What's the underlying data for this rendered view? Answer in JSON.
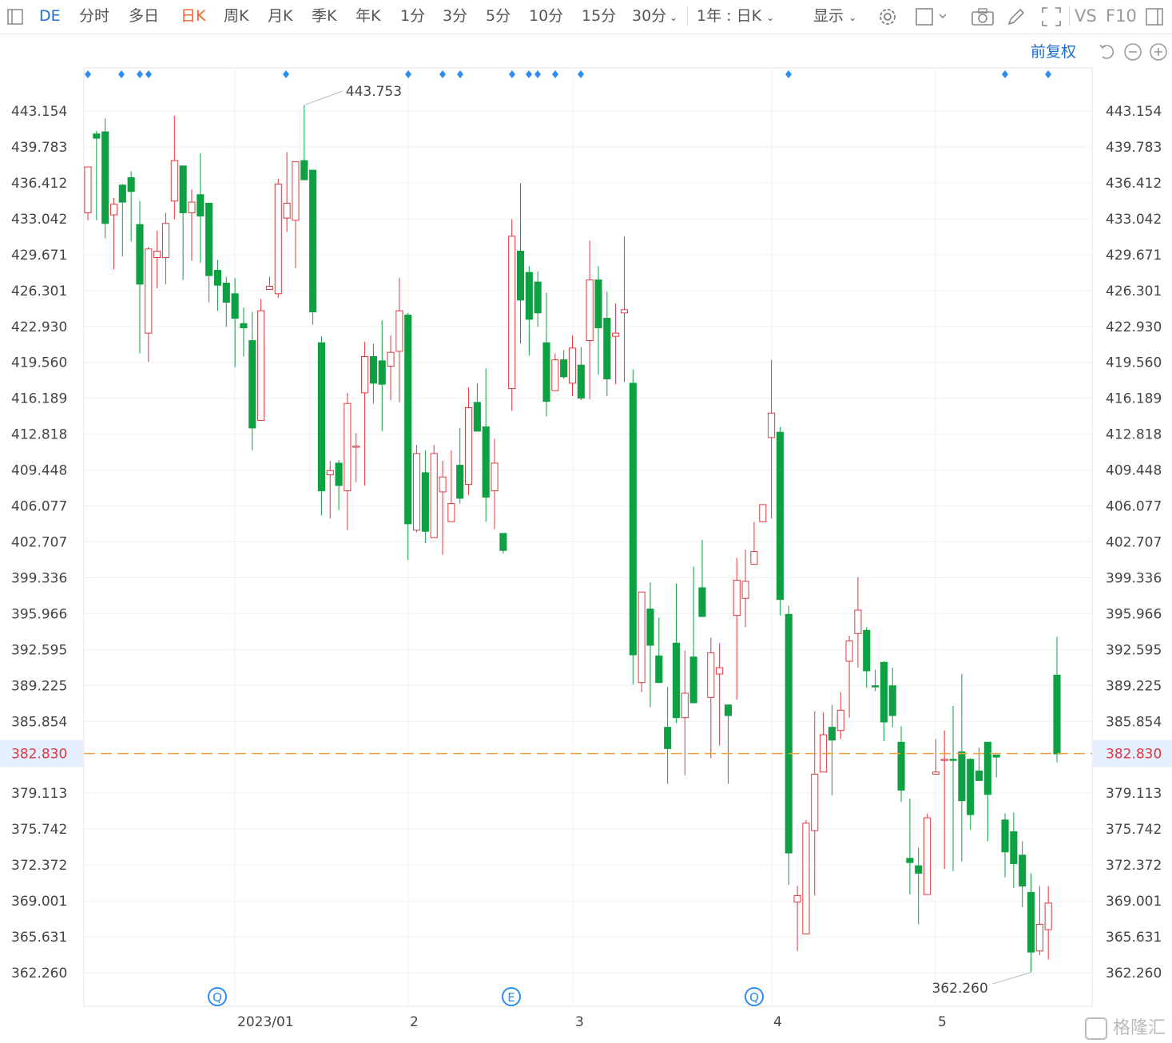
{
  "toolbar": {
    "symbol": "DE",
    "periods": [
      "分时",
      "多日",
      "日K",
      "周K",
      "月K",
      "季K",
      "年K",
      "1分",
      "3分",
      "5分",
      "10分",
      "15分",
      "30分"
    ],
    "active_period": "日K",
    "range_label": "1年 : 日K",
    "display_label": "显示",
    "vs_label": "VS",
    "f10_label": "F10",
    "adjust_label": "前复权"
  },
  "watermark": "格隆汇",
  "chart_data": {
    "type": "candlestick",
    "y_ticks": [
      "443.154",
      "439.783",
      "436.412",
      "433.042",
      "429.671",
      "426.301",
      "422.930",
      "419.560",
      "416.189",
      "412.818",
      "409.448",
      "406.077",
      "402.707",
      "399.336",
      "395.966",
      "392.595",
      "389.225",
      "385.854",
      "379.113",
      "375.742",
      "372.372",
      "369.001",
      "365.631",
      "362.260"
    ],
    "ylim": [
      362.26,
      443.154
    ],
    "current_price": 382.83,
    "current_price_label": "382.830",
    "max_label": "443.753",
    "min_label": "362.260",
    "x_labels": [
      "2023/01",
      "2",
      "3",
      "4",
      "5"
    ],
    "event_markers": [
      "Q",
      "E",
      "Q"
    ],
    "colors": {
      "up": "#e0393e",
      "down": "#0ea143",
      "current_line": "#f0a040"
    },
    "candles": [
      {
        "o": 433.6,
        "h": 437.2,
        "l": 432.9,
        "c": 437.9
      },
      {
        "o": 441.0,
        "h": 441.3,
        "l": 432.9,
        "c": 440.6
      },
      {
        "o": 441.2,
        "h": 442.5,
        "l": 431.2,
        "c": 432.6
      },
      {
        "o": 433.4,
        "h": 435.0,
        "l": 428.3,
        "c": 434.4
      },
      {
        "o": 436.2,
        "h": 436.3,
        "l": 429.5,
        "c": 434.6
      },
      {
        "o": 436.9,
        "h": 437.5,
        "l": 430.9,
        "c": 435.6
      },
      {
        "o": 432.5,
        "h": 434.7,
        "l": 420.4,
        "c": 426.9
      },
      {
        "o": 422.3,
        "h": 430.4,
        "l": 419.6,
        "c": 430.2
      },
      {
        "o": 429.4,
        "h": 431.9,
        "l": 426.5,
        "c": 430.0
      },
      {
        "o": 429.4,
        "h": 433.6,
        "l": 426.9,
        "c": 432.6
      },
      {
        "o": 434.7,
        "h": 442.7,
        "l": 433.0,
        "c": 438.5
      },
      {
        "o": 438.0,
        "h": 438.0,
        "l": 427.3,
        "c": 433.6
      },
      {
        "o": 433.6,
        "h": 435.8,
        "l": 429.1,
        "c": 434.6
      },
      {
        "o": 435.3,
        "h": 439.2,
        "l": 428.9,
        "c": 433.3
      },
      {
        "o": 434.5,
        "h": 434.5,
        "l": 425.2,
        "c": 427.7
      },
      {
        "o": 428.2,
        "h": 429.2,
        "l": 424.4,
        "c": 426.8
      },
      {
        "o": 427.0,
        "h": 427.6,
        "l": 422.9,
        "c": 425.2
      },
      {
        "o": 426.0,
        "h": 427.5,
        "l": 419.1,
        "c": 423.7
      },
      {
        "o": 423.2,
        "h": 424.7,
        "l": 420.1,
        "c": 422.8
      },
      {
        "o": 421.6,
        "h": 424.3,
        "l": 411.3,
        "c": 413.4
      },
      {
        "o": 414.1,
        "h": 425.5,
        "l": 414.1,
        "c": 424.4
      },
      {
        "o": 426.4,
        "h": 427.6,
        "l": 426.4,
        "c": 426.7
      },
      {
        "o": 426.0,
        "h": 436.8,
        "l": 425.6,
        "c": 436.3
      },
      {
        "o": 433.1,
        "h": 439.3,
        "l": 431.8,
        "c": 434.5
      },
      {
        "o": 432.9,
        "h": 437.7,
        "l": 428.4,
        "c": 438.4
      },
      {
        "o": 438.5,
        "h": 443.7,
        "l": 436.9,
        "c": 436.7
      },
      {
        "o": 437.6,
        "h": 437.6,
        "l": 423.1,
        "c": 424.3
      },
      {
        "o": 421.4,
        "h": 422.0,
        "l": 405.2,
        "c": 407.5
      },
      {
        "o": 409.0,
        "h": 410.3,
        "l": 404.9,
        "c": 409.4
      },
      {
        "o": 410.1,
        "h": 410.4,
        "l": 405.7,
        "c": 408.0
      },
      {
        "o": 407.5,
        "h": 416.7,
        "l": 403.8,
        "c": 415.7
      },
      {
        "o": 411.7,
        "h": 412.9,
        "l": 408.3,
        "c": 411.7
      },
      {
        "o": 416.7,
        "h": 421.5,
        "l": 408.0,
        "c": 420.1
      },
      {
        "o": 420.1,
        "h": 421.3,
        "l": 415.7,
        "c": 417.6
      },
      {
        "o": 419.7,
        "h": 423.5,
        "l": 413.1,
        "c": 417.5
      },
      {
        "o": 419.2,
        "h": 422.1,
        "l": 416.0,
        "c": 420.5
      },
      {
        "o": 420.6,
        "h": 427.5,
        "l": 415.8,
        "c": 424.4
      },
      {
        "o": 424.0,
        "h": 424.2,
        "l": 401.0,
        "c": 404.4
      },
      {
        "o": 403.8,
        "h": 411.8,
        "l": 403.6,
        "c": 411.0
      },
      {
        "o": 409.2,
        "h": 411.3,
        "l": 402.6,
        "c": 403.7
      },
      {
        "o": 403.1,
        "h": 411.8,
        "l": 403.3,
        "c": 411.0
      },
      {
        "o": 407.4,
        "h": 410.3,
        "l": 401.5,
        "c": 408.8
      },
      {
        "o": 404.6,
        "h": 411.3,
        "l": 404.7,
        "c": 406.3
      },
      {
        "o": 409.9,
        "h": 413.4,
        "l": 406.3,
        "c": 406.8
      },
      {
        "o": 408.1,
        "h": 417.2,
        "l": 407.1,
        "c": 415.3
      },
      {
        "o": 415.8,
        "h": 417.6,
        "l": 413.8,
        "c": 413.1
      },
      {
        "o": 413.5,
        "h": 419.0,
        "l": 404.6,
        "c": 406.9
      },
      {
        "o": 407.5,
        "h": 412.4,
        "l": 403.9,
        "c": 410.1
      },
      {
        "o": 403.5,
        "h": 402.4,
        "l": 401.6,
        "c": 401.9
      },
      {
        "o": 417.1,
        "h": 433.0,
        "l": 415.0,
        "c": 431.4
      },
      {
        "o": 430.0,
        "h": 436.4,
        "l": 421.3,
        "c": 425.4
      },
      {
        "o": 428.0,
        "h": 428.6,
        "l": 420.2,
        "c": 423.6
      },
      {
        "o": 427.1,
        "h": 428.1,
        "l": 422.9,
        "c": 424.2
      },
      {
        "o": 421.4,
        "h": 426.1,
        "l": 414.5,
        "c": 415.9
      },
      {
        "o": 416.9,
        "h": 420.4,
        "l": 417.4,
        "c": 419.8
      },
      {
        "o": 419.8,
        "h": 420.7,
        "l": 418.0,
        "c": 418.2
      },
      {
        "o": 417.6,
        "h": 422.1,
        "l": 416.4,
        "c": 420.9
      },
      {
        "o": 419.3,
        "h": 421.0,
        "l": 416.0,
        "c": 416.2
      },
      {
        "o": 421.6,
        "h": 431.0,
        "l": 416.1,
        "c": 427.3
      },
      {
        "o": 427.3,
        "h": 428.6,
        "l": 418.4,
        "c": 422.8
      },
      {
        "o": 423.7,
        "h": 426.2,
        "l": 416.4,
        "c": 418.0
      },
      {
        "o": 422.0,
        "h": 425.1,
        "l": 417.5,
        "c": 422.3
      },
      {
        "o": 424.2,
        "h": 431.4,
        "l": 417.7,
        "c": 424.5
      },
      {
        "o": 417.6,
        "h": 418.9,
        "l": 389.3,
        "c": 392.1
      },
      {
        "o": 389.5,
        "h": 396.4,
        "l": 388.6,
        "c": 398.0
      },
      {
        "o": 396.4,
        "h": 398.9,
        "l": 387.2,
        "c": 393.0
      },
      {
        "o": 392.0,
        "h": 395.6,
        "l": 390.6,
        "c": 389.5
      },
      {
        "o": 385.3,
        "h": 389.1,
        "l": 380.0,
        "c": 383.3
      },
      {
        "o": 393.2,
        "h": 398.8,
        "l": 385.7,
        "c": 386.2
      },
      {
        "o": 386.2,
        "h": 392.5,
        "l": 380.8,
        "c": 388.5
      },
      {
        "o": 391.9,
        "h": 400.4,
        "l": 389.1,
        "c": 387.6
      },
      {
        "o": 398.4,
        "h": 402.9,
        "l": 396.0,
        "c": 395.7
      },
      {
        "o": 388.1,
        "h": 393.7,
        "l": 382.4,
        "c": 392.3
      },
      {
        "o": 390.3,
        "h": 393.2,
        "l": 383.6,
        "c": 390.9
      },
      {
        "o": 387.4,
        "h": 386.9,
        "l": 380.0,
        "c": 386.4
      },
      {
        "o": 395.8,
        "h": 401.2,
        "l": 387.9,
        "c": 399.1
      },
      {
        "o": 397.4,
        "h": 402.0,
        "l": 394.7,
        "c": 399.0
      },
      {
        "o": 400.6,
        "h": 404.6,
        "l": 401.9,
        "c": 401.8
      },
      {
        "o": 404.6,
        "h": 406.1,
        "l": 405.6,
        "c": 406.2
      },
      {
        "o": 412.5,
        "h": 419.8,
        "l": 404.9,
        "c": 414.8
      },
      {
        "o": 413.0,
        "h": 413.5,
        "l": 395.8,
        "c": 397.3
      },
      {
        "o": 395.9,
        "h": 396.7,
        "l": 370.5,
        "c": 373.5
      },
      {
        "o": 368.9,
        "h": 370.4,
        "l": 364.3,
        "c": 369.5
      },
      {
        "o": 365.9,
        "h": 376.6,
        "l": 367.8,
        "c": 376.3
      },
      {
        "o": 375.6,
        "h": 386.8,
        "l": 369.5,
        "c": 380.9
      },
      {
        "o": 381.1,
        "h": 386.7,
        "l": 382.0,
        "c": 384.6
      },
      {
        "o": 385.3,
        "h": 387.4,
        "l": 378.9,
        "c": 384.1
      },
      {
        "o": 385.0,
        "h": 388.6,
        "l": 384.2,
        "c": 386.9
      },
      {
        "o": 391.5,
        "h": 393.9,
        "l": 386.2,
        "c": 393.4
      },
      {
        "o": 394.1,
        "h": 399.4,
        "l": 390.9,
        "c": 396.3
      },
      {
        "o": 394.4,
        "h": 394.7,
        "l": 389.0,
        "c": 390.6
      },
      {
        "o": 389.2,
        "h": 390.7,
        "l": 388.7,
        "c": 389.1
      },
      {
        "o": 391.4,
        "h": 391.5,
        "l": 384.0,
        "c": 385.8
      },
      {
        "o": 389.2,
        "h": 390.9,
        "l": 385.3,
        "c": 386.4
      },
      {
        "o": 383.9,
        "h": 385.4,
        "l": 378.3,
        "c": 379.4
      },
      {
        "o": 373.0,
        "h": 378.6,
        "l": 369.6,
        "c": 372.6
      },
      {
        "o": 372.3,
        "h": 374.0,
        "l": 366.8,
        "c": 371.6
      },
      {
        "o": 369.6,
        "h": 377.2,
        "l": 370.6,
        "c": 376.8
      },
      {
        "o": 380.9,
        "h": 384.2,
        "l": 381.2,
        "c": 381.1
      },
      {
        "o": 382.2,
        "h": 385.0,
        "l": 372.0,
        "c": 382.3
      },
      {
        "o": 382.3,
        "h": 387.3,
        "l": 371.8,
        "c": 382.2
      },
      {
        "o": 383.0,
        "h": 390.3,
        "l": 372.7,
        "c": 378.4
      },
      {
        "o": 382.3,
        "h": 382.4,
        "l": 375.7,
        "c": 377.1
      },
      {
        "o": 381.2,
        "h": 383.4,
        "l": 381.6,
        "c": 380.3
      },
      {
        "o": 383.9,
        "h": 383.8,
        "l": 374.6,
        "c": 379.0
      },
      {
        "o": 382.7,
        "h": 382.7,
        "l": 380.6,
        "c": 382.5
      },
      {
        "o": 376.6,
        "h": 377.2,
        "l": 371.2,
        "c": 373.6
      },
      {
        "o": 375.5,
        "h": 377.3,
        "l": 370.2,
        "c": 372.5
      },
      {
        "o": 373.3,
        "h": 374.6,
        "l": 368.4,
        "c": 370.4
      },
      {
        "o": 369.8,
        "h": 371.6,
        "l": 362.3,
        "c": 364.2
      },
      {
        "o": 364.3,
        "h": 370.4,
        "l": 363.9,
        "c": 366.8
      },
      {
        "o": 366.3,
        "h": 370.4,
        "l": 363.5,
        "c": 368.8
      },
      {
        "o": 390.2,
        "h": 393.8,
        "l": 382.0,
        "c": 382.8
      }
    ]
  }
}
